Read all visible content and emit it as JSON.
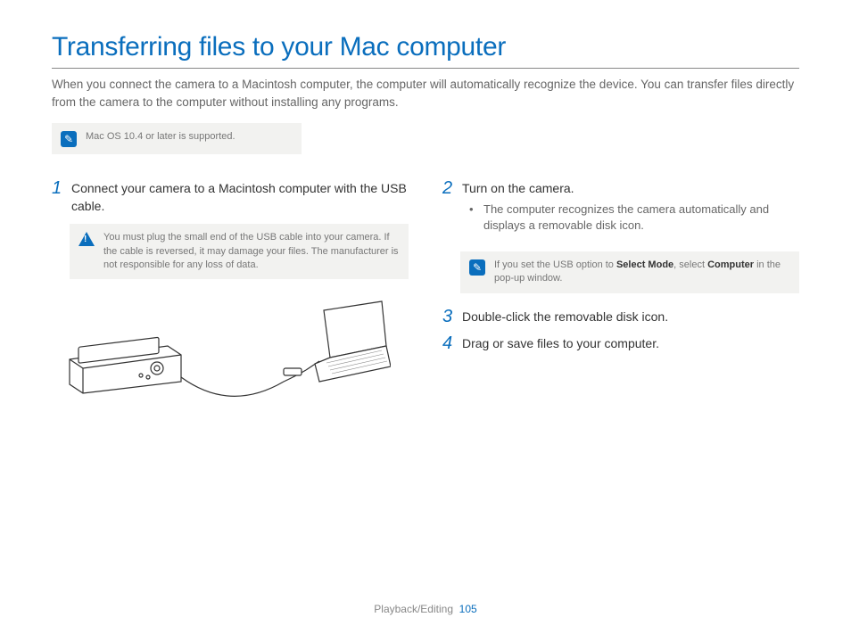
{
  "title": "Transferring files to your Mac computer",
  "intro": "When you connect the camera to a Macintosh computer, the computer will automatically recognize the device. You can transfer files directly from the camera to the computer without installing any programs.",
  "note_top": "Mac OS 10.4 or later is supported.",
  "steps": {
    "s1": {
      "num": "1",
      "text": "Connect your camera to a Macintosh computer with the USB cable."
    },
    "s2": {
      "num": "2",
      "text": "Turn on the camera.",
      "bullet": "The computer recognizes the camera automatically and displays a removable disk icon."
    },
    "s3": {
      "num": "3",
      "text": "Double-click the removable disk icon."
    },
    "s4": {
      "num": "4",
      "text": "Drag or save files to your computer."
    }
  },
  "warning": "You must plug the small end of the USB cable into your camera. If the cable is reversed, it may damage your files. The manufacturer is not responsible for any loss of data.",
  "note2_pre": "If you set the USB option to ",
  "note2_b1": "Select Mode",
  "note2_mid": ", select ",
  "note2_b2": "Computer",
  "note2_post": " in the pop-up window.",
  "footer": {
    "section": "Playback/Editing",
    "page": "105"
  }
}
